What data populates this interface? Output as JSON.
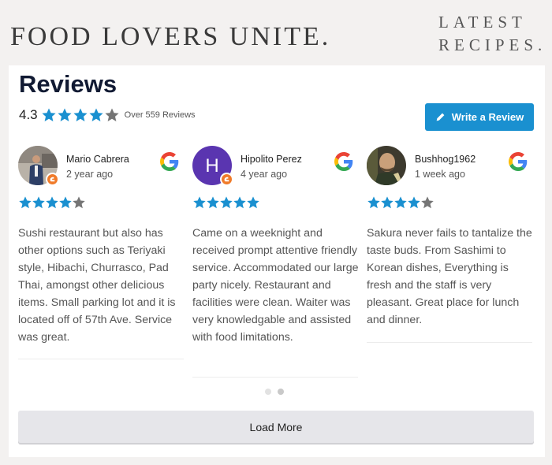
{
  "site": {
    "title": "FOOD LOVERS UNITE.",
    "nav": [
      "LATEST",
      "RECIPES."
    ]
  },
  "reviews": {
    "heading": "Reviews",
    "average": "4.3",
    "average_stars_filled": 4,
    "total_stars": 5,
    "count_label": "Over 559 Reviews",
    "write_button": "Write a Review",
    "load_more": "Load More",
    "page_dots": 2,
    "active_dot": 2,
    "colors": {
      "star_filled": "#1a90d0",
      "star_empty": "#757575",
      "button": "#1a90d0"
    },
    "items": [
      {
        "name": "Mario Cabrera",
        "time": "2 year ago",
        "rating": 4,
        "source_icon": "google-icon",
        "avatar": "photo",
        "text": "Sushi restaurant but also has other options such as Teriyaki style, Hibachi, Churrasco, Pad Thai, amongst other delicious items. Small parking lot and it is located off of 57th Ave. Service was great."
      },
      {
        "name": "Hipolito Perez",
        "time": "4 year ago",
        "rating": 5,
        "source_icon": "google-icon",
        "avatar": "H",
        "avatar_color": "#5a35b0",
        "text": "Came on a weeknight and received prompt attentive friendly service. Accommodated our large party nicely. Restaurant and facilities were clean. Waiter was very knowledgable and assisted with food limitations."
      },
      {
        "name": "Bushhog1962",
        "time": "1 week ago",
        "rating": 4,
        "source_icon": "google-icon",
        "avatar": "photo",
        "text": "Sakura never fails to tantalize the taste buds. From Sashimi to Korean dishes, Everything is fresh and the staff is very pleasant. Great place for lunch and dinner."
      }
    ]
  }
}
